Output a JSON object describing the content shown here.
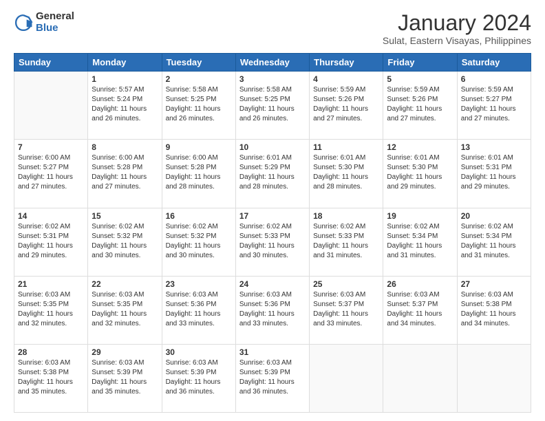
{
  "header": {
    "logo": {
      "general": "General",
      "blue": "Blue"
    },
    "title": "January 2024",
    "subtitle": "Sulat, Eastern Visayas, Philippines"
  },
  "calendar": {
    "days_of_week": [
      "Sunday",
      "Monday",
      "Tuesday",
      "Wednesday",
      "Thursday",
      "Friday",
      "Saturday"
    ],
    "weeks": [
      [
        {
          "day": "",
          "sunrise": "",
          "sunset": "",
          "daylight": ""
        },
        {
          "day": "1",
          "sunrise": "Sunrise: 5:57 AM",
          "sunset": "Sunset: 5:24 PM",
          "daylight": "Daylight: 11 hours and 26 minutes."
        },
        {
          "day": "2",
          "sunrise": "Sunrise: 5:58 AM",
          "sunset": "Sunset: 5:25 PM",
          "daylight": "Daylight: 11 hours and 26 minutes."
        },
        {
          "day": "3",
          "sunrise": "Sunrise: 5:58 AM",
          "sunset": "Sunset: 5:25 PM",
          "daylight": "Daylight: 11 hours and 26 minutes."
        },
        {
          "day": "4",
          "sunrise": "Sunrise: 5:59 AM",
          "sunset": "Sunset: 5:26 PM",
          "daylight": "Daylight: 11 hours and 27 minutes."
        },
        {
          "day": "5",
          "sunrise": "Sunrise: 5:59 AM",
          "sunset": "Sunset: 5:26 PM",
          "daylight": "Daylight: 11 hours and 27 minutes."
        },
        {
          "day": "6",
          "sunrise": "Sunrise: 5:59 AM",
          "sunset": "Sunset: 5:27 PM",
          "daylight": "Daylight: 11 hours and 27 minutes."
        }
      ],
      [
        {
          "day": "7",
          "sunrise": "Sunrise: 6:00 AM",
          "sunset": "Sunset: 5:27 PM",
          "daylight": "Daylight: 11 hours and 27 minutes."
        },
        {
          "day": "8",
          "sunrise": "Sunrise: 6:00 AM",
          "sunset": "Sunset: 5:28 PM",
          "daylight": "Daylight: 11 hours and 27 minutes."
        },
        {
          "day": "9",
          "sunrise": "Sunrise: 6:00 AM",
          "sunset": "Sunset: 5:28 PM",
          "daylight": "Daylight: 11 hours and 28 minutes."
        },
        {
          "day": "10",
          "sunrise": "Sunrise: 6:01 AM",
          "sunset": "Sunset: 5:29 PM",
          "daylight": "Daylight: 11 hours and 28 minutes."
        },
        {
          "day": "11",
          "sunrise": "Sunrise: 6:01 AM",
          "sunset": "Sunset: 5:30 PM",
          "daylight": "Daylight: 11 hours and 28 minutes."
        },
        {
          "day": "12",
          "sunrise": "Sunrise: 6:01 AM",
          "sunset": "Sunset: 5:30 PM",
          "daylight": "Daylight: 11 hours and 29 minutes."
        },
        {
          "day": "13",
          "sunrise": "Sunrise: 6:01 AM",
          "sunset": "Sunset: 5:31 PM",
          "daylight": "Daylight: 11 hours and 29 minutes."
        }
      ],
      [
        {
          "day": "14",
          "sunrise": "Sunrise: 6:02 AM",
          "sunset": "Sunset: 5:31 PM",
          "daylight": "Daylight: 11 hours and 29 minutes."
        },
        {
          "day": "15",
          "sunrise": "Sunrise: 6:02 AM",
          "sunset": "Sunset: 5:32 PM",
          "daylight": "Daylight: 11 hours and 30 minutes."
        },
        {
          "day": "16",
          "sunrise": "Sunrise: 6:02 AM",
          "sunset": "Sunset: 5:32 PM",
          "daylight": "Daylight: 11 hours and 30 minutes."
        },
        {
          "day": "17",
          "sunrise": "Sunrise: 6:02 AM",
          "sunset": "Sunset: 5:33 PM",
          "daylight": "Daylight: 11 hours and 30 minutes."
        },
        {
          "day": "18",
          "sunrise": "Sunrise: 6:02 AM",
          "sunset": "Sunset: 5:33 PM",
          "daylight": "Daylight: 11 hours and 31 minutes."
        },
        {
          "day": "19",
          "sunrise": "Sunrise: 6:02 AM",
          "sunset": "Sunset: 5:34 PM",
          "daylight": "Daylight: 11 hours and 31 minutes."
        },
        {
          "day": "20",
          "sunrise": "Sunrise: 6:02 AM",
          "sunset": "Sunset: 5:34 PM",
          "daylight": "Daylight: 11 hours and 31 minutes."
        }
      ],
      [
        {
          "day": "21",
          "sunrise": "Sunrise: 6:03 AM",
          "sunset": "Sunset: 5:35 PM",
          "daylight": "Daylight: 11 hours and 32 minutes."
        },
        {
          "day": "22",
          "sunrise": "Sunrise: 6:03 AM",
          "sunset": "Sunset: 5:35 PM",
          "daylight": "Daylight: 11 hours and 32 minutes."
        },
        {
          "day": "23",
          "sunrise": "Sunrise: 6:03 AM",
          "sunset": "Sunset: 5:36 PM",
          "daylight": "Daylight: 11 hours and 33 minutes."
        },
        {
          "day": "24",
          "sunrise": "Sunrise: 6:03 AM",
          "sunset": "Sunset: 5:36 PM",
          "daylight": "Daylight: 11 hours and 33 minutes."
        },
        {
          "day": "25",
          "sunrise": "Sunrise: 6:03 AM",
          "sunset": "Sunset: 5:37 PM",
          "daylight": "Daylight: 11 hours and 33 minutes."
        },
        {
          "day": "26",
          "sunrise": "Sunrise: 6:03 AM",
          "sunset": "Sunset: 5:37 PM",
          "daylight": "Daylight: 11 hours and 34 minutes."
        },
        {
          "day": "27",
          "sunrise": "Sunrise: 6:03 AM",
          "sunset": "Sunset: 5:38 PM",
          "daylight": "Daylight: 11 hours and 34 minutes."
        }
      ],
      [
        {
          "day": "28",
          "sunrise": "Sunrise: 6:03 AM",
          "sunset": "Sunset: 5:38 PM",
          "daylight": "Daylight: 11 hours and 35 minutes."
        },
        {
          "day": "29",
          "sunrise": "Sunrise: 6:03 AM",
          "sunset": "Sunset: 5:39 PM",
          "daylight": "Daylight: 11 hours and 35 minutes."
        },
        {
          "day": "30",
          "sunrise": "Sunrise: 6:03 AM",
          "sunset": "Sunset: 5:39 PM",
          "daylight": "Daylight: 11 hours and 36 minutes."
        },
        {
          "day": "31",
          "sunrise": "Sunrise: 6:03 AM",
          "sunset": "Sunset: 5:39 PM",
          "daylight": "Daylight: 11 hours and 36 minutes."
        },
        {
          "day": "",
          "sunrise": "",
          "sunset": "",
          "daylight": ""
        },
        {
          "day": "",
          "sunrise": "",
          "sunset": "",
          "daylight": ""
        },
        {
          "day": "",
          "sunrise": "",
          "sunset": "",
          "daylight": ""
        }
      ]
    ]
  }
}
